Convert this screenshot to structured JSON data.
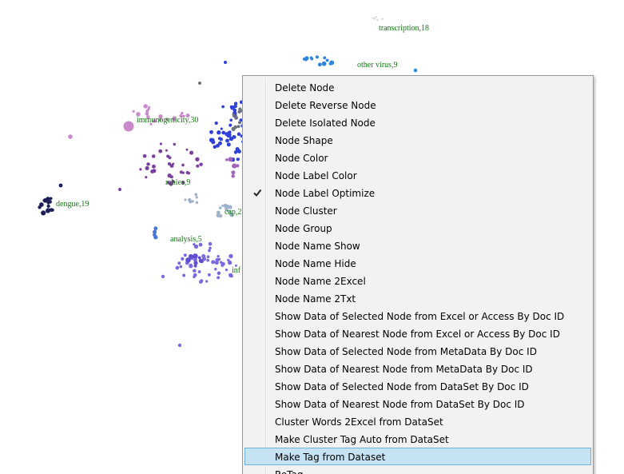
{
  "graph": {
    "cluster_labels": [
      {
        "id": "transcription",
        "text": "transcription,18"
      },
      {
        "id": "other-virus",
        "text": "other virus,9"
      },
      {
        "id": "immunogenicity",
        "text": "immunogenicity,30"
      },
      {
        "id": "rabies",
        "text": "rabies,9"
      },
      {
        "id": "dengue",
        "text": "dengue,19"
      },
      {
        "id": "cap",
        "text": "cap,2"
      },
      {
        "id": "analysis",
        "text": "analysis,5"
      },
      {
        "id": "inf",
        "text": "inf"
      }
    ],
    "colors": {
      "label": "#0f7a0f",
      "blue": "#2f3fd9",
      "navy": "#1c1f5a",
      "purple": "#7b3fa0",
      "pink": "#c98ac9",
      "steel": "#9fb3cc",
      "gray": "#6b7280",
      "lavender": "#7a6ae0",
      "sky": "#2e86de"
    }
  },
  "context_menu": {
    "items": [
      {
        "label": "Delete Node",
        "checked": false,
        "highlighted": false
      },
      {
        "label": "Delete Reverse Node",
        "checked": false,
        "highlighted": false
      },
      {
        "label": "Delete Isolated Node",
        "checked": false,
        "highlighted": false
      },
      {
        "label": "Node Shape",
        "checked": false,
        "highlighted": false
      },
      {
        "label": "Node Color",
        "checked": false,
        "highlighted": false
      },
      {
        "label": "Node Label Color",
        "checked": false,
        "highlighted": false
      },
      {
        "label": "Node Label Optimize",
        "checked": true,
        "highlighted": false
      },
      {
        "label": "Node Cluster",
        "checked": false,
        "highlighted": false
      },
      {
        "label": "Node Group",
        "checked": false,
        "highlighted": false
      },
      {
        "label": "Node Name Show",
        "checked": false,
        "highlighted": false
      },
      {
        "label": "Node Name Hide",
        "checked": false,
        "highlighted": false
      },
      {
        "label": "Node Name 2Excel",
        "checked": false,
        "highlighted": false
      },
      {
        "label": "Node Name 2Txt",
        "checked": false,
        "highlighted": false
      },
      {
        "label": "Show Data of Selected Node from Excel or Access By Doc ID",
        "checked": false,
        "highlighted": false
      },
      {
        "label": "Show Data of Nearest Node from Excel or Access By Doc ID",
        "checked": false,
        "highlighted": false
      },
      {
        "label": "Show Data of Selected Node from MetaData By Doc ID",
        "checked": false,
        "highlighted": false
      },
      {
        "label": "Show Data of Nearest Node from MetaData By Doc ID",
        "checked": false,
        "highlighted": false
      },
      {
        "label": "Show Data of Selected Node from DataSet By Doc ID",
        "checked": false,
        "highlighted": false
      },
      {
        "label": "Show Data of Nearest Node from DataSet By Doc ID",
        "checked": false,
        "highlighted": false
      },
      {
        "label": "Cluster Words 2Excel from DataSet",
        "checked": false,
        "highlighted": false
      },
      {
        "label": "Make Cluster Tag Auto from DataSet",
        "checked": false,
        "highlighted": false
      },
      {
        "label": "Make Tag from Dataset",
        "checked": false,
        "highlighted": true
      },
      {
        "label": "ReTag",
        "checked": false,
        "highlighted": false
      }
    ]
  }
}
